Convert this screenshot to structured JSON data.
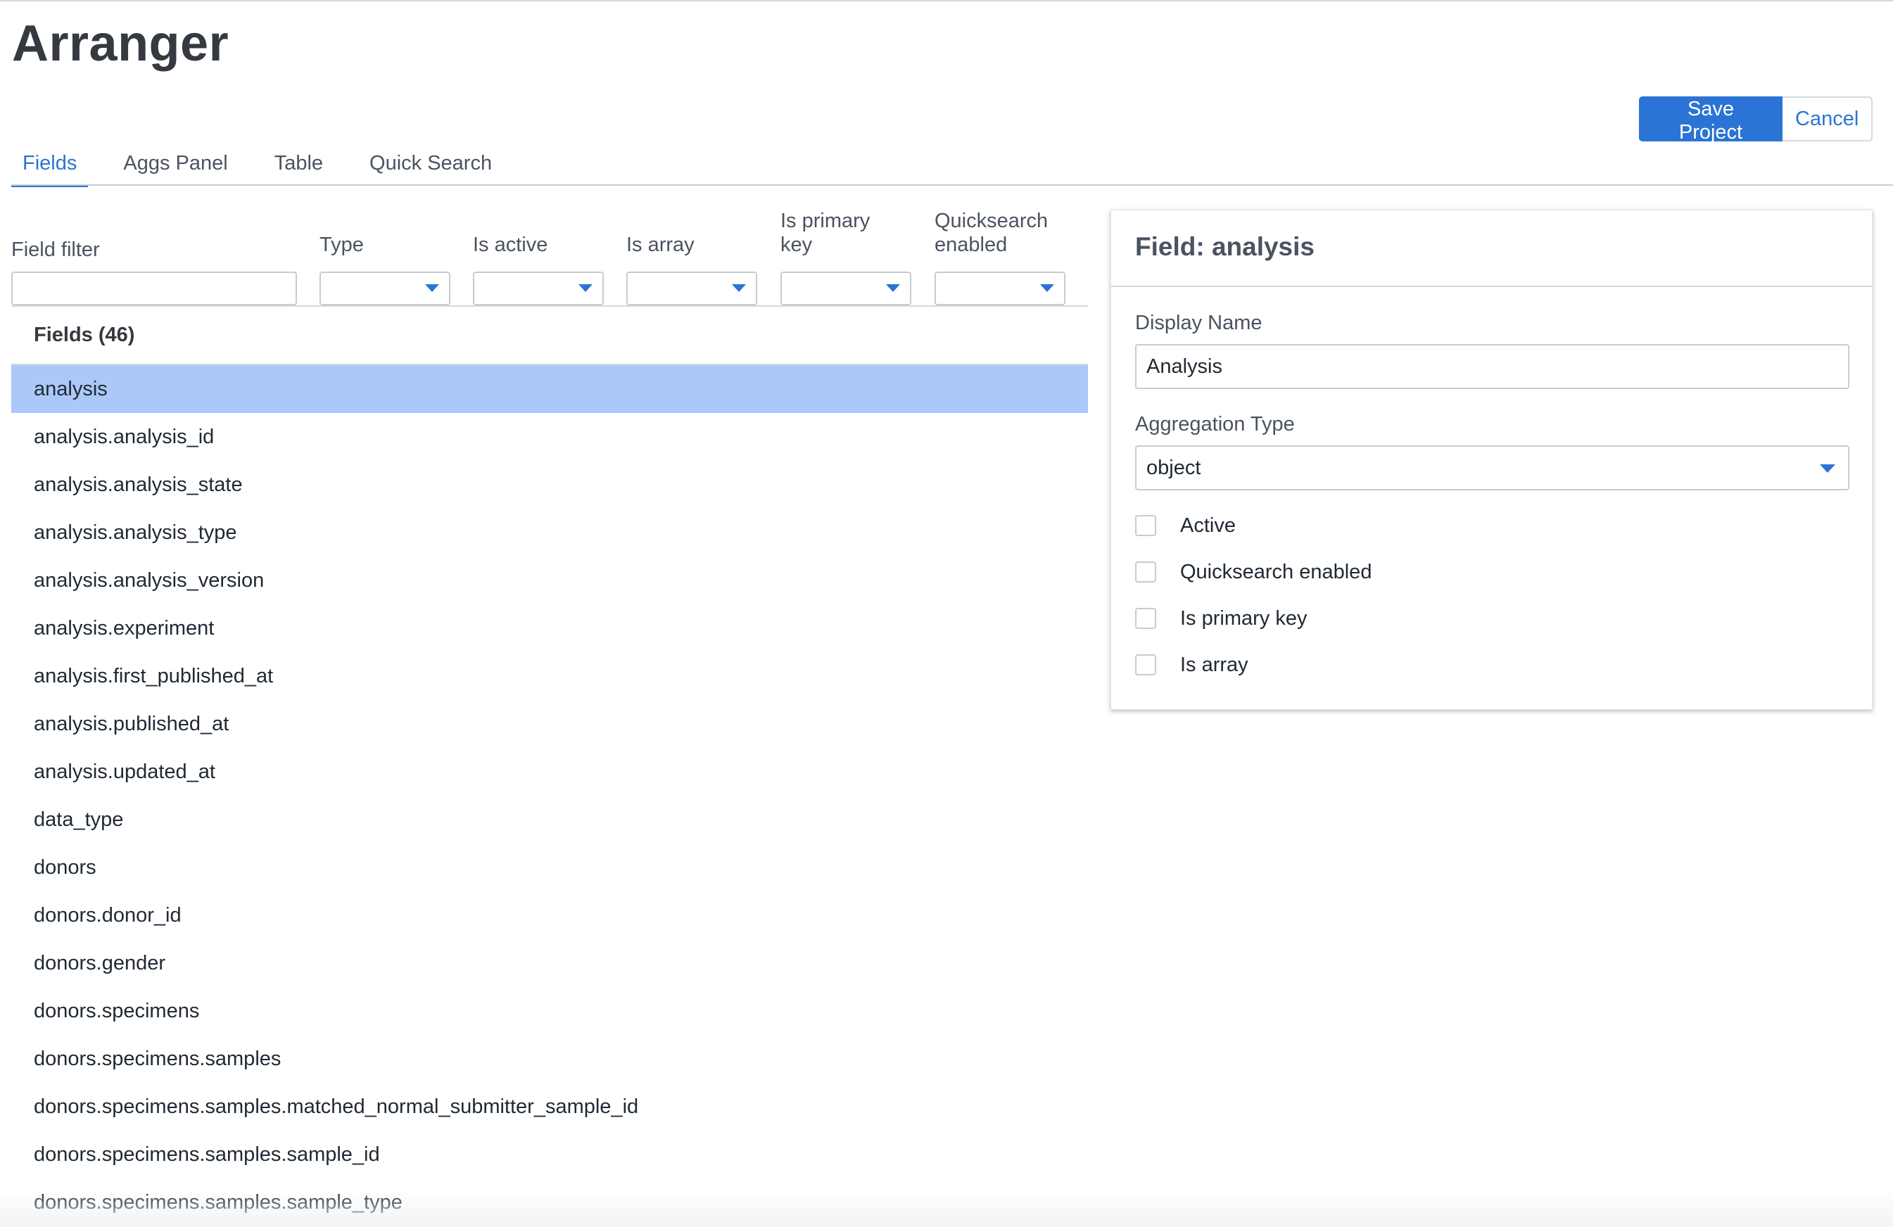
{
  "app": {
    "title": "Arranger"
  },
  "actions": {
    "save_label": "Save Project",
    "cancel_label": "Cancel"
  },
  "tabs": [
    {
      "label": "Fields",
      "active": true
    },
    {
      "label": "Aggs Panel",
      "active": false
    },
    {
      "label": "Table",
      "active": false
    },
    {
      "label": "Quick Search",
      "active": false
    }
  ],
  "filters": {
    "field_filter": {
      "label": "Field filter",
      "value": ""
    },
    "type": {
      "label": "Type",
      "value": ""
    },
    "is_active": {
      "label": "Is active",
      "value": ""
    },
    "is_array": {
      "label": "Is array",
      "value": ""
    },
    "is_primary_key": {
      "label_line1": "Is primary",
      "label_line2": "key",
      "value": ""
    },
    "quicksearch_enabled": {
      "label_line1": "Quicksearch",
      "label_line2": "enabled",
      "value": ""
    }
  },
  "list": {
    "header": "Fields (46)",
    "selected": "analysis",
    "items": [
      "analysis",
      "analysis.analysis_id",
      "analysis.analysis_state",
      "analysis.analysis_type",
      "analysis.analysis_version",
      "analysis.experiment",
      "analysis.first_published_at",
      "analysis.published_at",
      "analysis.updated_at",
      "data_type",
      "donors",
      "donors.donor_id",
      "donors.gender",
      "donors.specimens",
      "donors.specimens.samples",
      "donors.specimens.samples.matched_normal_submitter_sample_id",
      "donors.specimens.samples.sample_id",
      "donors.specimens.samples.sample_type"
    ]
  },
  "panel": {
    "title": "Field: analysis",
    "display_name_label": "Display Name",
    "display_name_value": "Analysis",
    "aggregation_type_label": "Aggregation Type",
    "aggregation_type_value": "object",
    "checks": [
      {
        "label": "Active",
        "checked": false
      },
      {
        "label": "Quicksearch enabled",
        "checked": false
      },
      {
        "label": "Is primary key",
        "checked": false
      },
      {
        "label": "Is array",
        "checked": false
      }
    ]
  },
  "icons": {
    "dropdown": "chevron-down-icon"
  },
  "colors": {
    "accent": "#2b74d5",
    "selected_row": "#abc8f9",
    "text": "#1f2933",
    "muted": "#4a5360"
  }
}
